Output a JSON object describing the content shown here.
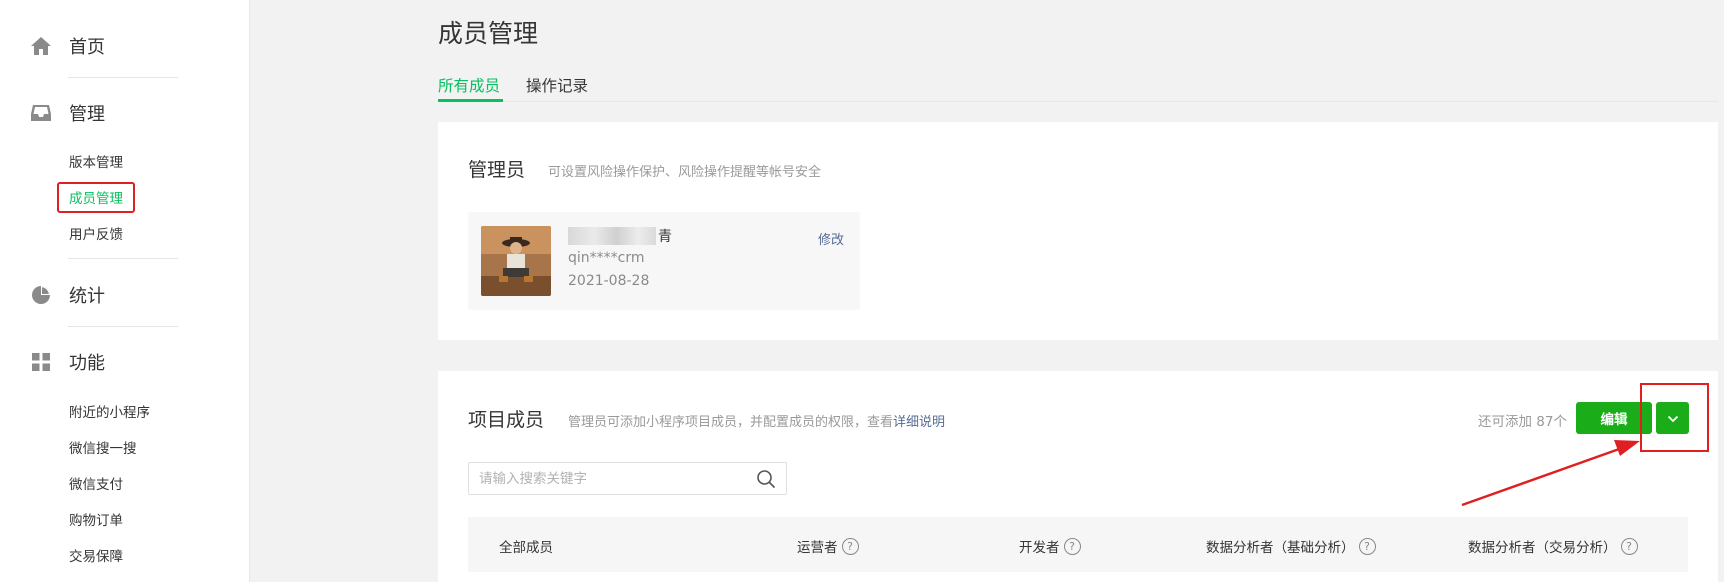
{
  "sidebar": {
    "home": {
      "label": "首页",
      "icon": "home-icon"
    },
    "manage": {
      "label": "管理",
      "icon": "inbox-icon"
    },
    "manage_items": [
      "版本管理",
      "成员管理",
      "用户反馈"
    ],
    "stats": {
      "label": "统计",
      "icon": "pie-chart-icon"
    },
    "features": {
      "label": "功能",
      "icon": "grid-icon"
    },
    "feature_items": [
      "附近的小程序",
      "微信搜一搜",
      "微信支付",
      "购物订单",
      "交易保障"
    ]
  },
  "page": {
    "title": "成员管理",
    "tabs": [
      "所有成员",
      "操作记录"
    ]
  },
  "admin_section": {
    "title": "管理员",
    "desc": "可设置风险操作保护、风险操作提醒等帐号安全",
    "admin": {
      "name_suffix": "青",
      "account": "qin****crm",
      "date": "2021-08-28",
      "edit_label": "修改"
    }
  },
  "members_section": {
    "title": "项目成员",
    "desc": "管理员可添加小程序项目成员，并配置成员的权限，查看",
    "desc_link": "详细说明",
    "remaining": "还可添加 87个",
    "edit_button": "编辑",
    "search_placeholder": "请输入搜索关键字",
    "columns": [
      "全部成员",
      "运营者",
      "开发者",
      "数据分析者（基础分析）",
      "数据分析者（交易分析）"
    ],
    "help_mark": "?"
  },
  "colors": {
    "accent": "#07c160",
    "button": "#1aad19",
    "link": "#576b95",
    "highlight": "#e02020"
  }
}
